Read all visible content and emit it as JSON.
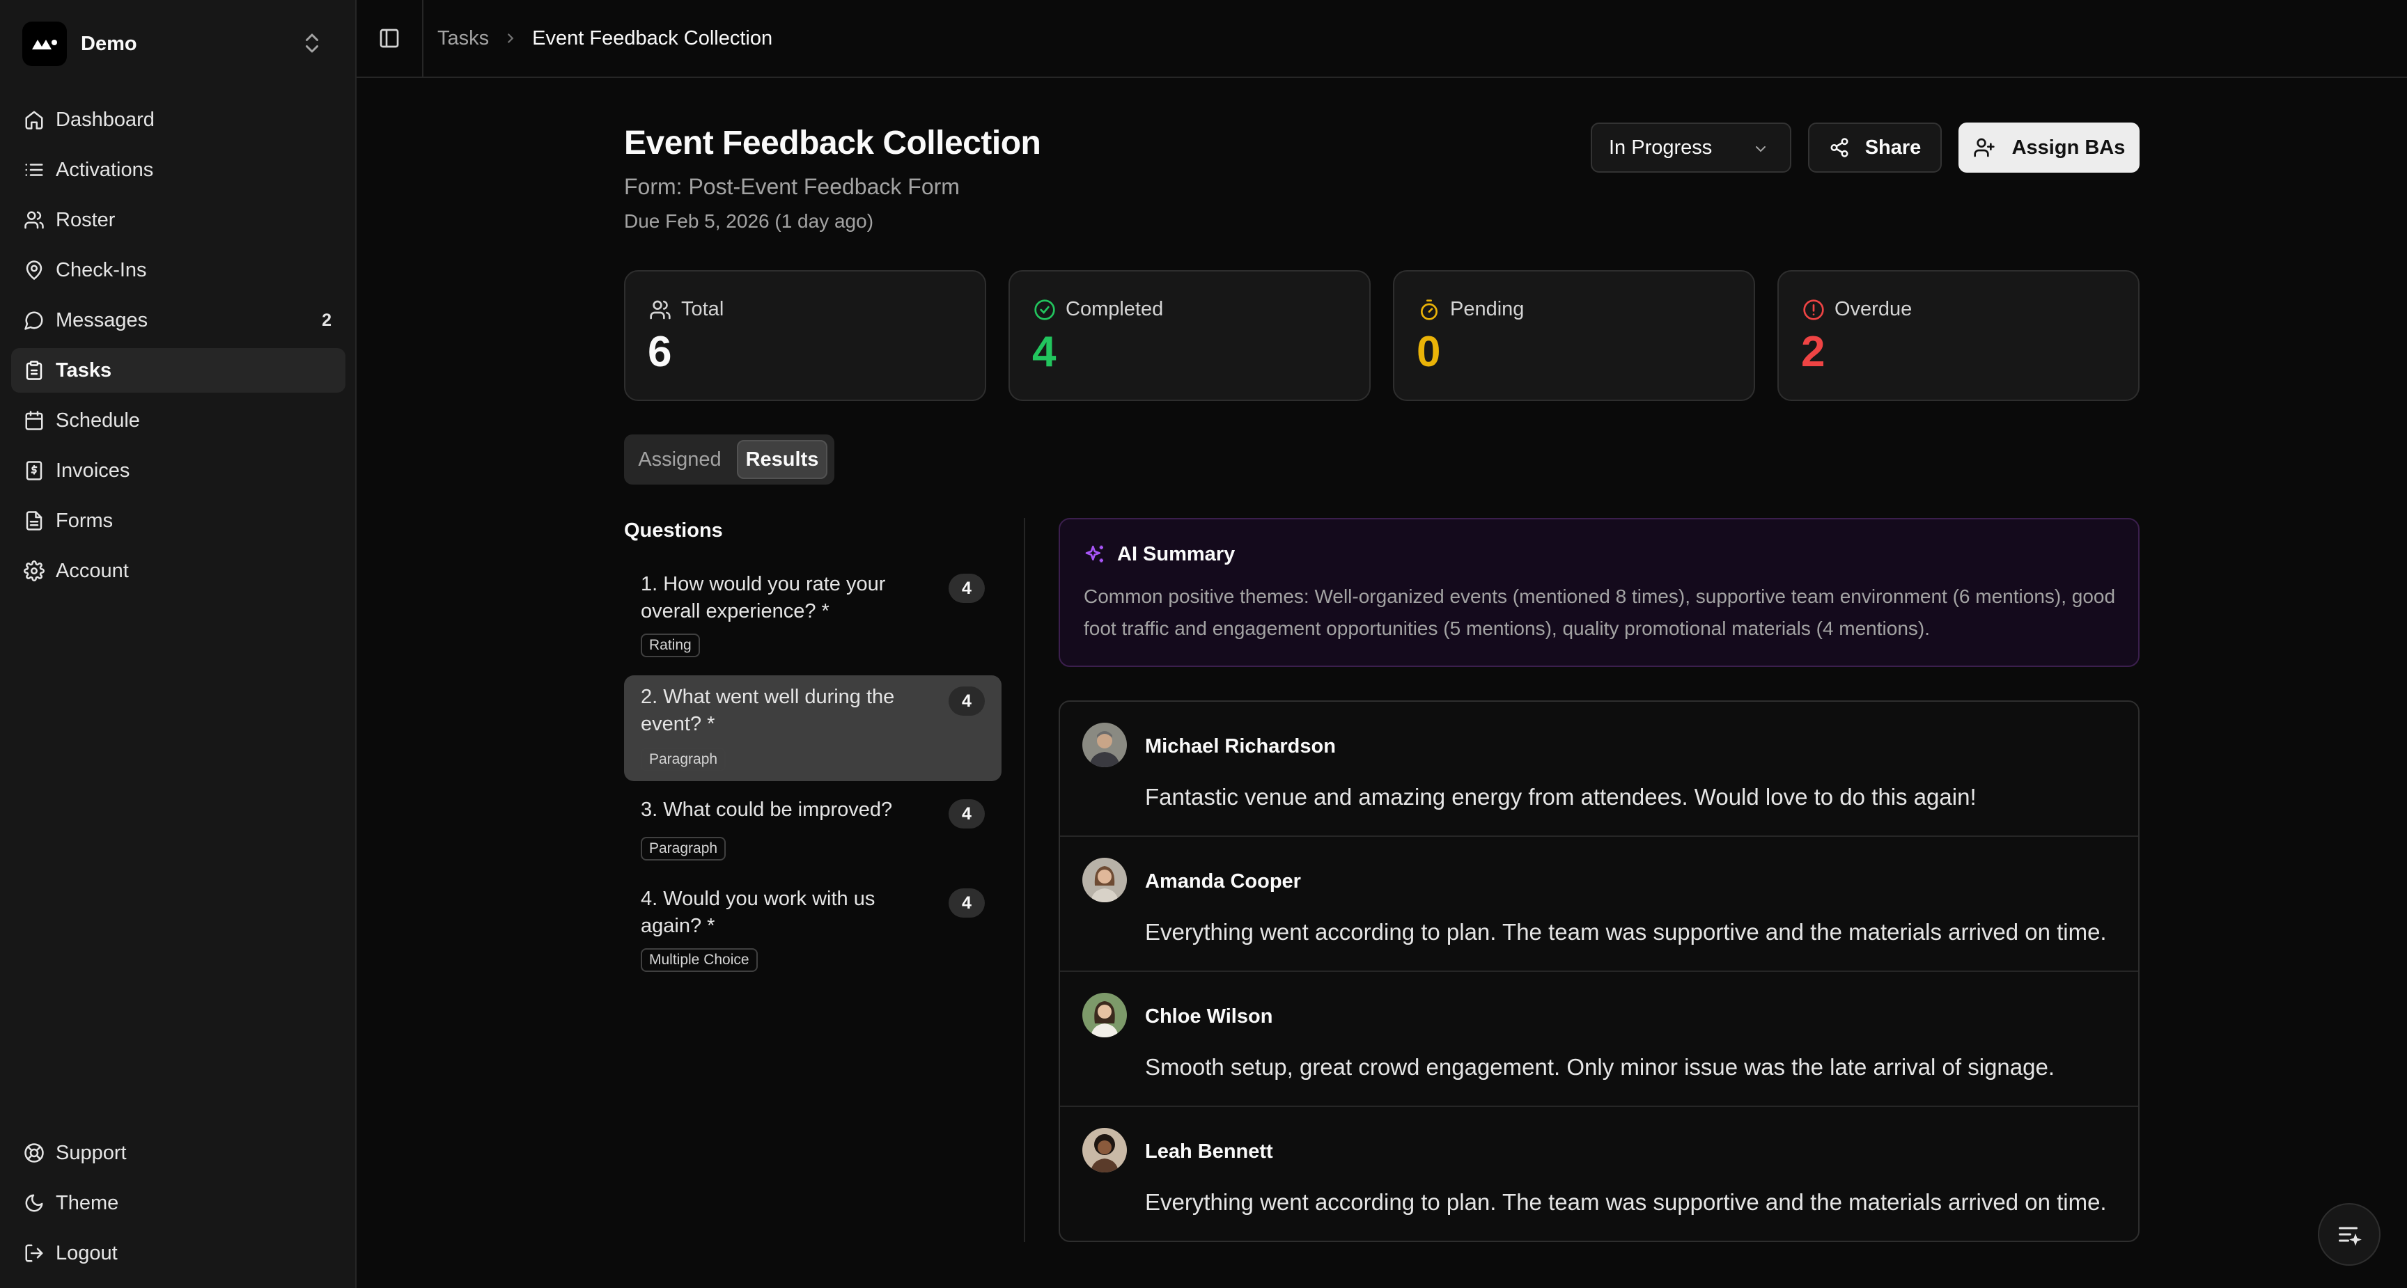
{
  "app": {
    "workspace_name": "Demo"
  },
  "sidebar": {
    "items": [
      {
        "label": "Dashboard",
        "icon": "home-icon"
      },
      {
        "label": "Activations",
        "icon": "list-icon"
      },
      {
        "label": "Roster",
        "icon": "users-icon"
      },
      {
        "label": "Check-Ins",
        "icon": "map-pin-icon"
      },
      {
        "label": "Messages",
        "icon": "message-icon",
        "badge": "2"
      },
      {
        "label": "Tasks",
        "icon": "clipboard-icon",
        "active": true
      },
      {
        "label": "Schedule",
        "icon": "calendar-icon"
      },
      {
        "label": "Invoices",
        "icon": "receipt-icon"
      },
      {
        "label": "Forms",
        "icon": "file-text-icon"
      },
      {
        "label": "Account",
        "icon": "gear-icon"
      }
    ],
    "bottom_items": [
      {
        "label": "Support",
        "icon": "life-buoy-icon"
      },
      {
        "label": "Theme",
        "icon": "moon-icon"
      },
      {
        "label": "Logout",
        "icon": "logout-icon"
      }
    ]
  },
  "breadcrumb": {
    "parent": "Tasks",
    "current": "Event Feedback Collection"
  },
  "header": {
    "title": "Event Feedback Collection",
    "form": "Form: Post-Event Feedback Form",
    "due": "Due Feb 5, 2026 (1 day ago)",
    "status": "In Progress",
    "share_label": "Share",
    "assign_label": "Assign BAs"
  },
  "stats": [
    {
      "label": "Total",
      "value": "6",
      "color": "#fafafa",
      "icon": "users-icon"
    },
    {
      "label": "Completed",
      "value": "4",
      "color": "#22c55e",
      "icon": "check-circle-icon"
    },
    {
      "label": "Pending",
      "value": "0",
      "color": "#eab308",
      "icon": "timer-icon"
    },
    {
      "label": "Overdue",
      "value": "2",
      "color": "#ef4444",
      "icon": "alert-circle-icon"
    }
  ],
  "tabs": {
    "assigned": "Assigned",
    "results": "Results"
  },
  "questions": {
    "heading": "Questions",
    "items": [
      {
        "text": "1. How would you rate your overall experience? *",
        "count": "4",
        "type": "Rating"
      },
      {
        "text": "2. What went well during the event? *",
        "count": "4",
        "type": "Paragraph",
        "active": true
      },
      {
        "text": "3. What could be improved?",
        "count": "4",
        "type": "Paragraph"
      },
      {
        "text": "4. Would you work with us again? *",
        "count": "4",
        "type": "Multiple Choice"
      }
    ]
  },
  "ai_summary": {
    "title": "AI Summary",
    "text": "Common positive themes: Well-organized events (mentioned 8 times), supportive team environment (6 mentions), good foot traffic and engagement opportunities (5 mentions), quality promotional materials (4 mentions)."
  },
  "responses": [
    {
      "name": "Michael Richardson",
      "text": "Fantastic venue and amazing energy from attendees. Would love to do this again!"
    },
    {
      "name": "Amanda Cooper",
      "text": "Everything went according to plan. The team was supportive and the materials arrived on time."
    },
    {
      "name": "Chloe Wilson",
      "text": "Smooth setup, great crowd engagement. Only minor issue was the late arrival of signage."
    },
    {
      "name": "Leah Bennett",
      "text": "Everything went according to plan. The team was supportive and the materials arrived on time."
    }
  ]
}
